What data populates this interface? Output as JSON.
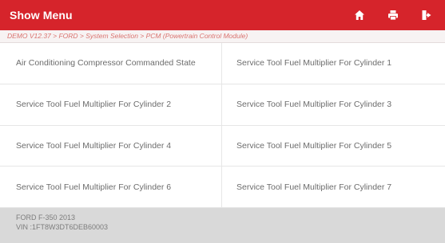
{
  "header": {
    "title": "Show Menu",
    "accent_color": "#d6242b",
    "icons": [
      "home-icon",
      "printer-icon",
      "exit-icon"
    ]
  },
  "breadcrumb": {
    "text": "DEMO V12.37 > FORD > System Selection > PCM (Powertrain Control Module)"
  },
  "menu": {
    "items": [
      {
        "label": "Air Conditioning Compressor Commanded State"
      },
      {
        "label": "Service Tool Fuel Multiplier For Cylinder 1"
      },
      {
        "label": "Service Tool Fuel Multiplier For Cylinder 2"
      },
      {
        "label": "Service Tool Fuel Multiplier For Cylinder 3"
      },
      {
        "label": "Service Tool Fuel Multiplier For Cylinder 4"
      },
      {
        "label": "Service Tool Fuel Multiplier For Cylinder 5"
      },
      {
        "label": "Service Tool Fuel Multiplier For Cylinder 6"
      },
      {
        "label": "Service Tool Fuel Multiplier For Cylinder 7"
      }
    ]
  },
  "footer": {
    "vehicle": "FORD F-350 2013",
    "vin": "VIN :1FT8W3DT6DEB60003"
  }
}
